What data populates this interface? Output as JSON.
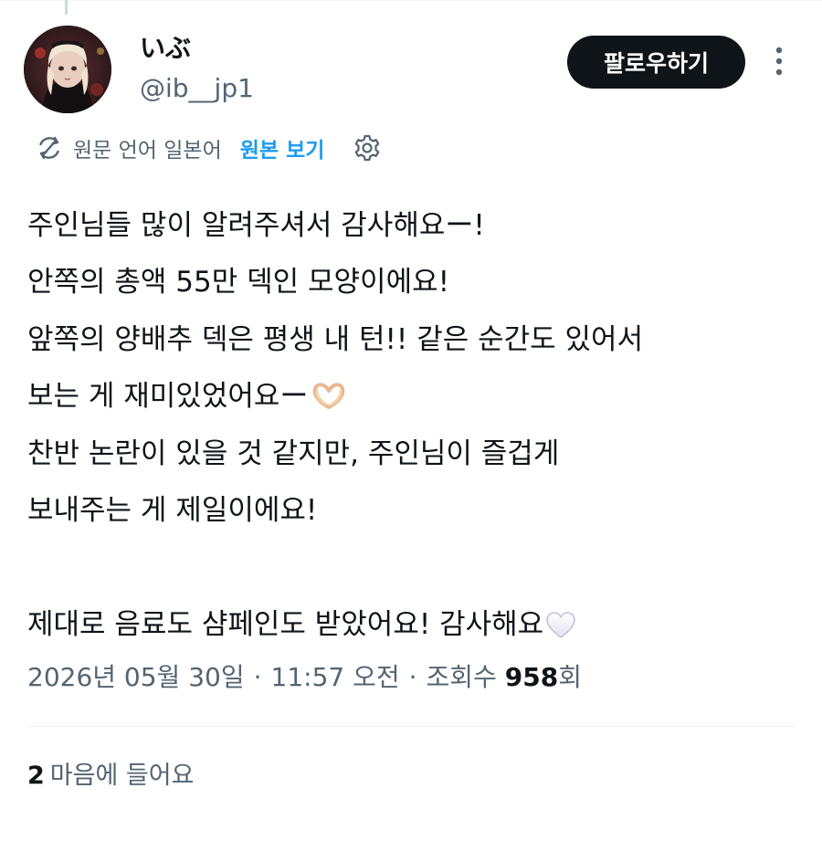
{
  "author": {
    "display_name": "いぶ",
    "handle": "@ib__jp1"
  },
  "follow_button": {
    "label": "팔로우하기"
  },
  "translation": {
    "language_note": "원문 언어 일본어",
    "show_original_label": "원본 보기"
  },
  "tweet": {
    "lines": [
      "주인님들 많이 알려주셔서 감사해요ー!",
      "안쪽의 총액 55만 덱인 모양이에요!",
      "앞쪽의 양배추 덱은 평생 내 턴!! 같은 순간도 있어서",
      "보는 게 재미있었어요ー",
      "찬반 논란이 있을 것 같지만, 주인님이 즐겁게",
      "보내주는 게 제일이에요!",
      "",
      "제대로 음료도 샴페인도 받았어요! 감사해요"
    ]
  },
  "meta": {
    "date": "2026년 05월 30일",
    "separator": "·",
    "time": "11:57 오전",
    "views_label": "조회수",
    "views_count": "958",
    "views_suffix": "회"
  },
  "engagement": {
    "likes_count": "2",
    "likes_label": "마음에 들어요"
  },
  "colors": {
    "accent": "#1d9bf0",
    "text_primary": "#0f1419",
    "text_secondary": "#536471",
    "button_bg": "#0f1419",
    "divider": "#eff3f4"
  },
  "icons": {
    "translate": "translate-icon",
    "settings": "gear-icon",
    "more": "more-vertical-icon",
    "emoji_1": "heart-hands-emoji",
    "emoji_2": "white-heart-emoji"
  }
}
